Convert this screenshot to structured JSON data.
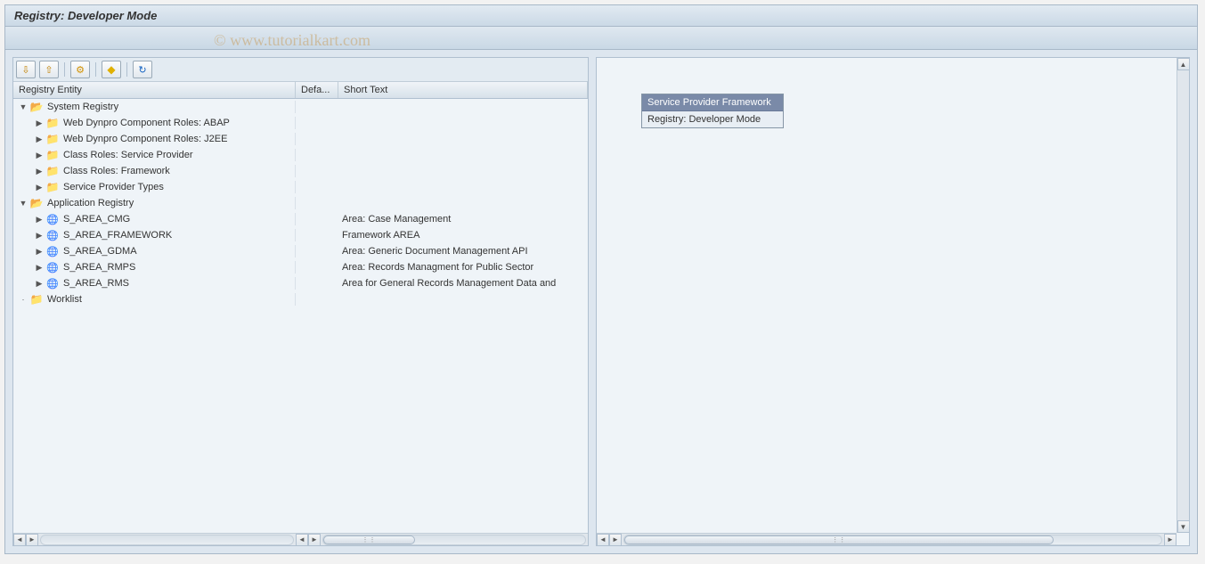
{
  "window": {
    "title": "Registry: Developer Mode"
  },
  "watermark": "© www.tutorialkart.com",
  "tree": {
    "columns": {
      "entity": "Registry Entity",
      "defa": "Defa...",
      "short": "Short Text"
    },
    "rows": [
      {
        "indent": 0,
        "expander": "▼",
        "icon": "folder-open",
        "label": "System Registry",
        "short": ""
      },
      {
        "indent": 1,
        "expander": "▶",
        "icon": "folder-closed",
        "label": "Web Dynpro Component Roles: ABAP",
        "short": ""
      },
      {
        "indent": 1,
        "expander": "▶",
        "icon": "folder-closed",
        "label": "Web Dynpro Component Roles: J2EE",
        "short": ""
      },
      {
        "indent": 1,
        "expander": "▶",
        "icon": "folder-closed",
        "label": "Class Roles: Service Provider",
        "short": ""
      },
      {
        "indent": 1,
        "expander": "▶",
        "icon": "folder-closed",
        "label": "Class Roles: Framework",
        "short": ""
      },
      {
        "indent": 1,
        "expander": "▶",
        "icon": "folder-closed",
        "label": "Service Provider Types",
        "short": ""
      },
      {
        "indent": 0,
        "expander": "▼",
        "icon": "folder-open",
        "label": "Application Registry",
        "short": ""
      },
      {
        "indent": 1,
        "expander": "▶",
        "icon": "globe-icon",
        "label": "S_AREA_CMG",
        "short": "Area: Case Management"
      },
      {
        "indent": 1,
        "expander": "▶",
        "icon": "globe-icon",
        "label": "S_AREA_FRAMEWORK",
        "short": "Framework AREA"
      },
      {
        "indent": 1,
        "expander": "▶",
        "icon": "globe-icon",
        "label": "S_AREA_GDMA",
        "short": "Area: Generic Document Management API"
      },
      {
        "indent": 1,
        "expander": "▶",
        "icon": "globe-icon",
        "label": "S_AREA_RMPS",
        "short": "Area: Records Managment for Public Sector"
      },
      {
        "indent": 1,
        "expander": "▶",
        "icon": "globe-icon",
        "label": "S_AREA_RMS",
        "short": "Area for General Records Management Data and"
      },
      {
        "indent": 0,
        "expander": "·",
        "icon": "folder-closed",
        "label": "Worklist",
        "short": ""
      }
    ]
  },
  "infobox": {
    "header": "Service Provider Framework",
    "body": "Registry: Developer Mode"
  },
  "toolbar_icons": {
    "expand_all": "⇩",
    "collapse_all": "⇧",
    "settings": "⚙",
    "legend": "◆",
    "refresh": "↻"
  }
}
